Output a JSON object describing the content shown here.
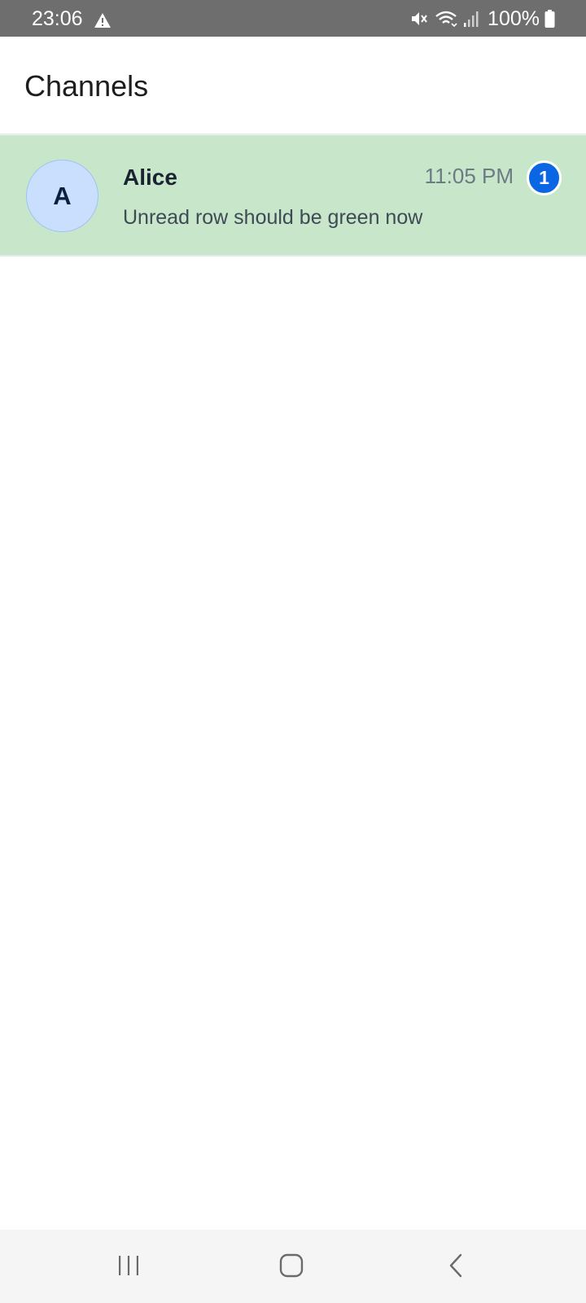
{
  "status_bar": {
    "time": "23:06",
    "left_icons": [
      "warning-icon"
    ],
    "right_icons": [
      "mute-icon",
      "wifi-icon",
      "signal-icon",
      "battery-icon"
    ],
    "battery": "100%"
  },
  "header": {
    "title": "Channels"
  },
  "channels": [
    {
      "avatar_letter": "A",
      "name": "Alice",
      "time": "11:05 PM",
      "unread_count": "1",
      "preview": "Unread row should be green now",
      "row_color": "#c8e6c9",
      "avatar_color": "#cadffe"
    }
  ],
  "nav_bar": {
    "buttons": [
      "recents-icon",
      "home-icon",
      "back-icon"
    ]
  },
  "colors": {
    "status_bar_bg": "#6e6e6e",
    "unread_row_bg": "#c8e6c9",
    "badge_bg": "#0b66e4"
  }
}
